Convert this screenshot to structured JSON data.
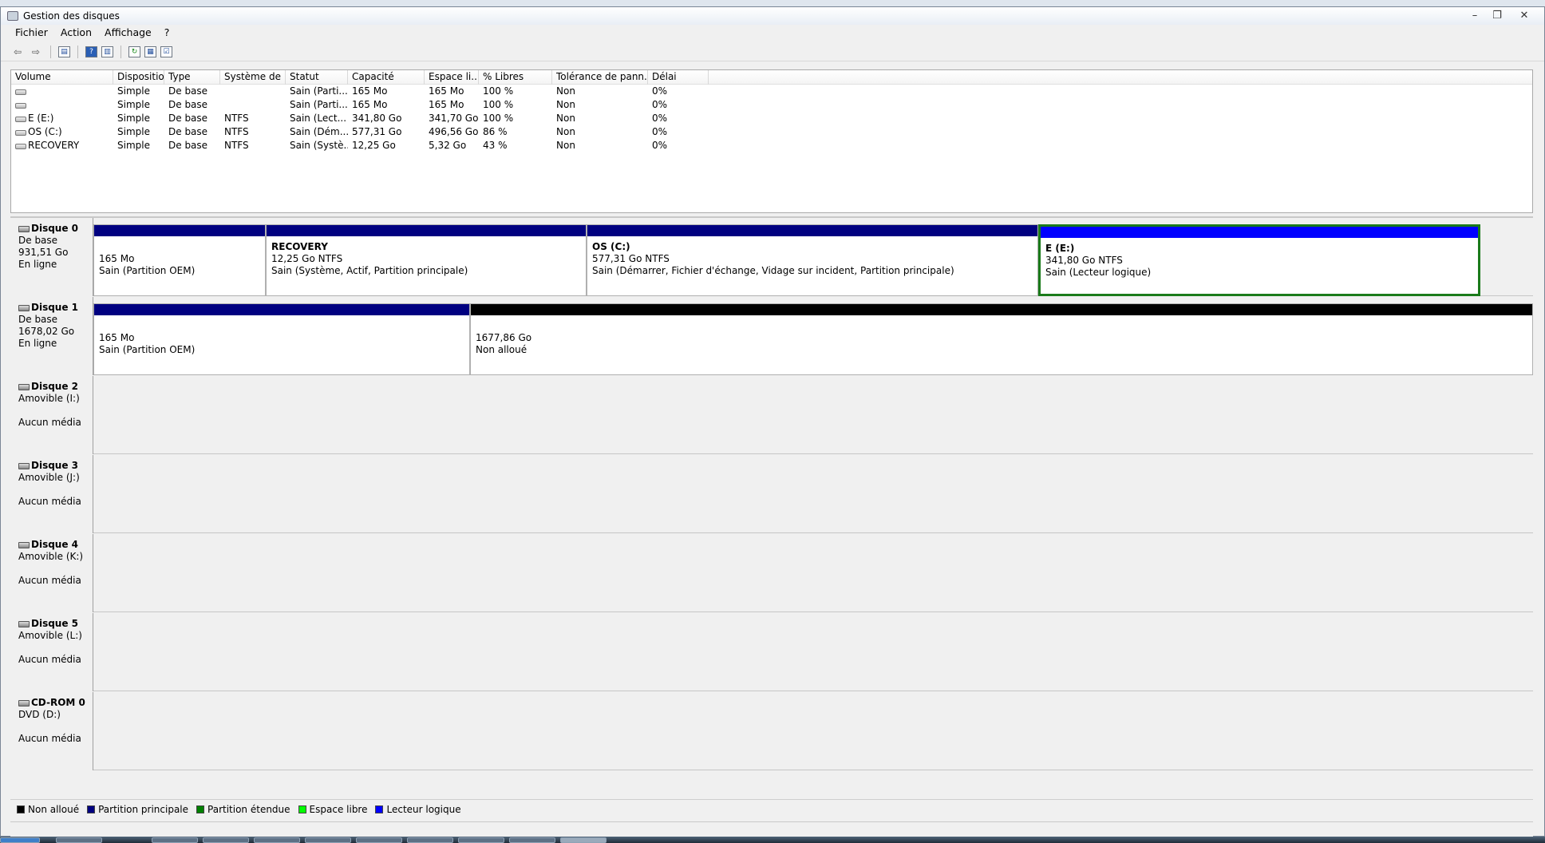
{
  "window": {
    "title": "Gestion des disques"
  },
  "menu": [
    "Fichier",
    "Action",
    "Affichage",
    "?"
  ],
  "toolbar_icons": [
    "back-icon",
    "forward-icon",
    "console-tree-icon",
    "help-icon",
    "properties-icon",
    "refresh-icon",
    "rescan-icon",
    "settings-icon"
  ],
  "volume_table": {
    "columns": [
      "Volume",
      "Disposition",
      "Type",
      "Système de ...",
      "Statut",
      "Capacité",
      "Espace li...",
      "% Libres",
      "Tolérance de pann...",
      "Délai"
    ],
    "rows": [
      [
        "",
        "Simple",
        "De base",
        "",
        "Sain (Parti...",
        "165 Mo",
        "165 Mo",
        "100 %",
        "Non",
        "0%"
      ],
      [
        "",
        "Simple",
        "De base",
        "",
        "Sain (Parti...",
        "165 Mo",
        "165 Mo",
        "100 %",
        "Non",
        "0%"
      ],
      [
        "E (E:)",
        "Simple",
        "De base",
        "NTFS",
        "Sain (Lect...",
        "341,80 Go",
        "341,70 Go",
        "100 %",
        "Non",
        "0%"
      ],
      [
        "OS (C:)",
        "Simple",
        "De base",
        "NTFS",
        "Sain (Dém...",
        "577,31 Go",
        "496,56 Go",
        "86 %",
        "Non",
        "0%"
      ],
      [
        "RECOVERY",
        "Simple",
        "De base",
        "NTFS",
        "Sain (Systè...",
        "12,25 Go",
        "5,32 Go",
        "43 %",
        "Non",
        "0%"
      ]
    ]
  },
  "disks": [
    {
      "name": "Disque 0",
      "line1": "De base",
      "line2": "931,51 Go",
      "line3": "En ligne",
      "partitions": [
        {
          "name": "",
          "size": "165 Mo",
          "status": "Sain (Partition OEM)",
          "bar": "#000080"
        },
        {
          "name": "RECOVERY",
          "size": "12,25 Go NTFS",
          "status": "Sain (Système, Actif, Partition principale)",
          "bar": "#000080"
        },
        {
          "name": "OS  (C:)",
          "size": "577,31 Go NTFS",
          "status": "Sain (Démarrer, Fichier d'échange, Vidage sur incident, Partition principale)",
          "bar": "#000080"
        },
        {
          "name": "E  (E:)",
          "size": "341,80 Go NTFS",
          "status": "Sain (Lecteur logique)",
          "bar": "#0000ff"
        }
      ]
    },
    {
      "name": "Disque 1",
      "line1": "De base",
      "line2": "1678,02 Go",
      "line3": "En ligne",
      "partitions": [
        {
          "name": "",
          "size": "165 Mo",
          "status": "Sain (Partition OEM)",
          "bar": "#000080"
        },
        {
          "name": "",
          "size": "1677,86 Go",
          "status": "Non alloué",
          "bar": "#000000"
        }
      ]
    },
    {
      "name": "Disque 2",
      "line1": "Amovible (I:)",
      "line2": "",
      "line3": "Aucun média"
    },
    {
      "name": "Disque 3",
      "line1": "Amovible (J:)",
      "line2": "",
      "line3": "Aucun média"
    },
    {
      "name": "Disque 4",
      "line1": "Amovible (K:)",
      "line2": "",
      "line3": "Aucun média"
    },
    {
      "name": "Disque 5",
      "line1": "Amovible (L:)",
      "line2": "",
      "line3": "Aucun média"
    },
    {
      "name": "CD-ROM 0",
      "line1": "DVD (D:)",
      "line2": "",
      "line3": "Aucun média"
    }
  ],
  "legend": [
    {
      "label": "Non alloué",
      "color": "#000000"
    },
    {
      "label": "Partition principale",
      "color": "#000080"
    },
    {
      "label": "Partition étendue",
      "color": "#008000"
    },
    {
      "label": "Espace libre",
      "color": "#00ff00"
    },
    {
      "label": "Lecteur logique",
      "color": "#0000ff"
    }
  ]
}
